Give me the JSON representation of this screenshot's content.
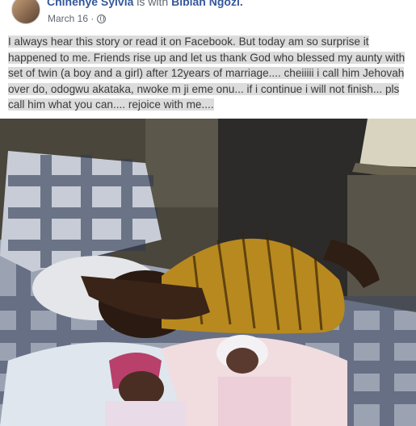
{
  "post": {
    "author": "Chinenye Sylvia",
    "with_label": " is with ",
    "tagged": "Bibian Ngozi.",
    "date": "March 16 · ",
    "privacy_icon": "globe-icon",
    "text": "I always hear this story or read it on Facebook. But today am so surprise it happened to me. Friends rise up and let us thank God who blessed my aunty with set of twin (a boy and a girl) after 12years of marriage.... cheiiiii i call him Jehovah over do, odogwu akataka, nwoke m ji eme onu... if i continue i will not finish... pls call him what you can.... rejoice with me...."
  },
  "colors": {
    "link": "#365899",
    "highlight": "#dcdcdc",
    "text": "#3a3a3a"
  }
}
